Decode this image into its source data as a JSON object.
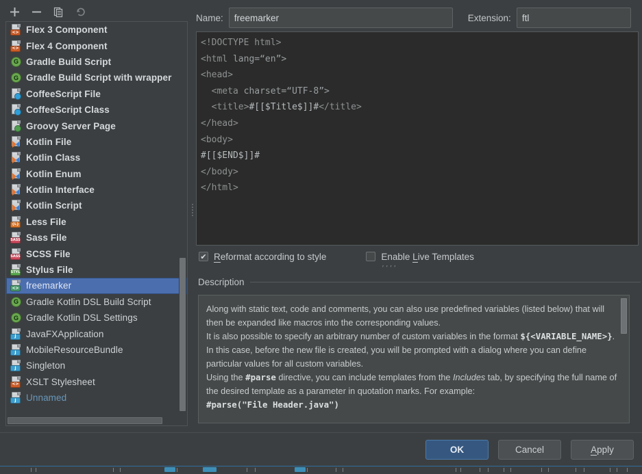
{
  "toolbar": {
    "buttons": [
      {
        "name": "add-template-button",
        "icon": "plus-icon",
        "title": "Add"
      },
      {
        "name": "remove-template-button",
        "icon": "minus-icon",
        "title": "Remove"
      },
      {
        "name": "copy-template-button",
        "icon": "copy-icon",
        "title": "Copy"
      },
      {
        "name": "reset-template-button",
        "icon": "undo-icon",
        "title": "Reset"
      }
    ]
  },
  "template_list": {
    "items": [
      {
        "label": "Flex 3 Component",
        "icon": "flex-file-icon",
        "badge": "<>",
        "badge_color": "#cc5c28",
        "bold": true,
        "selected": false,
        "blue": false
      },
      {
        "label": "Flex 4 Component",
        "icon": "flex-file-icon",
        "badge": "<>",
        "badge_color": "#cc5c28",
        "bold": true,
        "selected": false,
        "blue": false
      },
      {
        "label": "Gradle Build Script",
        "icon": "gradle-icon",
        "badge": "G",
        "badge_color": "#6aa84f",
        "bold": true,
        "selected": false,
        "blue": false
      },
      {
        "label": "Gradle Build Script with wrapper",
        "icon": "gradle-icon",
        "badge": "G",
        "badge_color": "#6aa84f",
        "bold": true,
        "selected": false,
        "blue": false
      },
      {
        "label": "CoffeeScript File",
        "icon": "coffeescript-icon",
        "badge": "C",
        "badge_color": "#2f9fd8",
        "bold": true,
        "selected": false,
        "blue": false
      },
      {
        "label": "CoffeeScript Class",
        "icon": "coffeescript-icon",
        "badge": "C",
        "badge_color": "#2f9fd8",
        "bold": true,
        "selected": false,
        "blue": false
      },
      {
        "label": "Groovy Server Page",
        "icon": "groovy-icon",
        "badge": "G",
        "badge_color": "#4f9e4f",
        "bold": true,
        "selected": false,
        "blue": false
      },
      {
        "label": "Kotlin File",
        "icon": "kotlin-icon",
        "badge": "K",
        "badge_color": "#e8742c",
        "bold": true,
        "selected": false,
        "blue": false
      },
      {
        "label": "Kotlin Class",
        "icon": "kotlin-icon",
        "badge": "K",
        "badge_color": "#e8742c",
        "bold": true,
        "selected": false,
        "blue": false
      },
      {
        "label": "Kotlin Enum",
        "icon": "kotlin-icon",
        "badge": "K",
        "badge_color": "#e8742c",
        "bold": true,
        "selected": false,
        "blue": false
      },
      {
        "label": "Kotlin Interface",
        "icon": "kotlin-icon",
        "badge": "K",
        "badge_color": "#e8742c",
        "bold": true,
        "selected": false,
        "blue": false
      },
      {
        "label": "Kotlin Script",
        "icon": "kotlin-icon",
        "badge": "K",
        "badge_color": "#e8742c",
        "bold": true,
        "selected": false,
        "blue": false
      },
      {
        "label": "Less File",
        "icon": "less-icon",
        "badge": "{L}",
        "badge_color": "#d9772b",
        "bold": true,
        "selected": false,
        "blue": false
      },
      {
        "label": "Sass File",
        "icon": "sass-icon",
        "badge": "SASS",
        "badge_color": "#cc4a5c",
        "bold": true,
        "selected": false,
        "blue": false
      },
      {
        "label": "SCSS File",
        "icon": "scss-icon",
        "badge": "SASS",
        "badge_color": "#cc4a5c",
        "bold": true,
        "selected": false,
        "blue": false
      },
      {
        "label": "Stylus File",
        "icon": "stylus-icon",
        "badge": "STYL",
        "badge_color": "#5aa84f",
        "bold": true,
        "selected": false,
        "blue": false
      },
      {
        "label": "freemarker",
        "icon": "freemarker-icon",
        "badge": "<>",
        "badge_color": "#4a9c6d",
        "bold": false,
        "selected": true,
        "blue": false
      },
      {
        "label": "Gradle Kotlin DSL Build Script",
        "icon": "gradle-icon",
        "badge": "G",
        "badge_color": "#6aa84f",
        "bold": false,
        "selected": false,
        "blue": false
      },
      {
        "label": "Gradle Kotlin DSL Settings",
        "icon": "gradle-icon",
        "badge": "G",
        "badge_color": "#6aa84f",
        "bold": false,
        "selected": false,
        "blue": false
      },
      {
        "label": "JavaFXApplication",
        "icon": "java-file-icon",
        "badge": "J",
        "badge_color": "#3d9fd0",
        "bold": false,
        "selected": false,
        "blue": false
      },
      {
        "label": "MobileResourceBundle",
        "icon": "java-file-icon",
        "badge": "J",
        "badge_color": "#3d9fd0",
        "bold": false,
        "selected": false,
        "blue": false
      },
      {
        "label": "Singleton",
        "icon": "java-file-icon",
        "badge": "J",
        "badge_color": "#3d9fd0",
        "bold": false,
        "selected": false,
        "blue": false
      },
      {
        "label": "XSLT Stylesheet",
        "icon": "xslt-icon",
        "badge": "<>",
        "badge_color": "#cc5c28",
        "bold": false,
        "selected": false,
        "blue": false
      },
      {
        "label": "Unnamed",
        "icon": "java-file-icon",
        "badge": "J",
        "badge_color": "#3d9fd0",
        "bold": false,
        "selected": false,
        "blue": true
      }
    ]
  },
  "form": {
    "name_label": "Name:",
    "name_value": "freemarker",
    "extension_label": "Extension:",
    "extension_value": "ftl"
  },
  "editor": {
    "lines": [
      {
        "segments": [
          {
            "t": "<!DOCTYPE html>",
            "c": "tag"
          }
        ]
      },
      {
        "segments": [
          {
            "t": "<html ",
            "c": "tag"
          },
          {
            "t": "lang=“en”>",
            "c": "attr"
          }
        ]
      },
      {
        "segments": [
          {
            "t": "<head>",
            "c": "tag"
          }
        ]
      },
      {
        "segments": [
          {
            "t": "  <meta ",
            "c": "tag"
          },
          {
            "t": "charset=“UTF-8”>",
            "c": "attr"
          }
        ]
      },
      {
        "segments": [
          {
            "t": "  <title>",
            "c": "tag"
          },
          {
            "t": "#[[$Title$]]#",
            "c": "tmpl"
          },
          {
            "t": "</title>",
            "c": "tag"
          }
        ]
      },
      {
        "segments": [
          {
            "t": "</head>",
            "c": "tag"
          }
        ]
      },
      {
        "segments": [
          {
            "t": "<body>",
            "c": "tag"
          }
        ]
      },
      {
        "segments": [
          {
            "t": "#[[$END$]]#",
            "c": "tmpl"
          }
        ]
      },
      {
        "segments": [
          {
            "t": "</body>",
            "c": "tag"
          }
        ]
      },
      {
        "segments": [
          {
            "t": "</html>",
            "c": "tag"
          }
        ]
      }
    ]
  },
  "options": {
    "reformat": {
      "label_pre": "R",
      "label_post": "eformat according to style",
      "checked": true,
      "check_glyph": "✔"
    },
    "live_templates": {
      "label_pre": "Enable ",
      "label_mnemonic": "L",
      "label_post": "ive Templates",
      "checked": false,
      "hint_dots": "’’’’"
    }
  },
  "description": {
    "header": "Description",
    "paragraphs": [
      {
        "type": "text",
        "text": "Along with static text, code and comments, you can also use predefined variables (listed below) that will then be expanded like macros into the corresponding values."
      },
      {
        "type": "mixed",
        "before": "It is also possible to specify an arbitrary number of custom variables in the format ",
        "mono": "${<VARIABLE_NAME>}",
        "after": ". In this case, before the new file is created, you will be prompted with a dialog where you can define particular values for all custom variables."
      },
      {
        "type": "parse",
        "before": "Using the ",
        "mono": "#parse",
        "mid": " directive, you can include templates from the ",
        "italic": "Includes",
        "after": " tab, by specifying the full name of the desired template as a parameter in quotation marks. For example:"
      },
      {
        "type": "code",
        "text": "#parse(\"File Header.java\")"
      }
    ]
  },
  "buttons": {
    "ok": "OK",
    "cancel": "Cancel",
    "apply_pre": "A",
    "apply_post": "pply"
  },
  "colors": {
    "window_bg": "#3c3f41",
    "editor_bg": "#2b2b2b",
    "selection_blue": "#4b6eaf",
    "primary_button": "#365880",
    "field_bg": "#45494a",
    "link_blue": "#6897bb"
  }
}
